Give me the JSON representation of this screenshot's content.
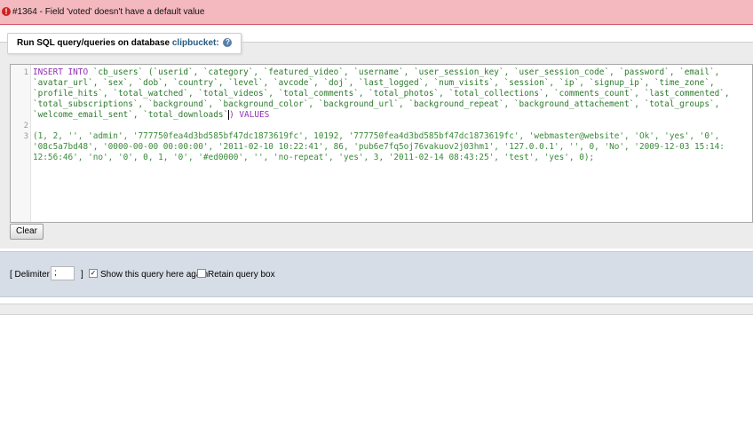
{
  "error": {
    "icon": "error-icon",
    "text": "#1364 - Field 'voted' doesn't have a default value"
  },
  "query_panel": {
    "legend_prefix": "Run SQL query/queries on database",
    "database": "clipbucket:",
    "help_icon": "help-icon"
  },
  "editor": {
    "line_numbers": [
      "1",
      "2",
      "3"
    ],
    "insert_keyword": "INSERT INTO",
    "sql_lines": [
      " `cb_users` (`userid`, `category`, `featured_video`, `username`, `user_session_key`, `user_session_code`, `password`, `email`,",
      "`avatar_url`, `sex`, `dob`, `country`, `level`, `avcode`, `doj`, `last_logged`, `num_visits`, `session`, `ip`, `signup_ip`, `time_zone`,",
      "`profile_hits`, `total_watched`, `total_videos`, `total_comments`, `total_photos`, `total_collections`, `comments_count`, `last_commented`,",
      "`total_subscriptions`, `background`, `background_color`, `background_url`, `background_repeat`, `background_attachement`, `total_groups`,",
      "`welcome_email_sent`, `total_downloads`"
    ],
    "values_keyword": ") VALUES",
    "value_lines": [
      "(1, 2, '', 'admin', '777750fea4d3bd585bf47dc1873619fc', 10192, '777750fea4d3bd585bf47dc1873619fc', 'webmaster@website', 'Ok', 'yes', '0',",
      "'08c5a7bd48', '0000-00-00 00:00:00', '2011-02-10 10:22:41', 86, 'pub6e7fq5oj76vakuov2j03hm1', '127.0.0.1', '', 0, 'No', '2009-12-03 15:14:",
      "12:56:46', 'no', '0', 0, 1, '0', '#ed0000', '', 'no-repeat', 'yes', 3, '2011-02-14 08:43:25', 'test', 'yes', 0);"
    ]
  },
  "buttons": {
    "clear": "Clear"
  },
  "options": {
    "delimiter_label": "[ Delimiter",
    "delimiter_value": ";",
    "delimiter_close": "]",
    "show_again_label": "Show this query here again",
    "show_again_checked": true,
    "retain_label": "Retain query box",
    "retain_checked": false
  },
  "colors": {
    "error_bg": "#f4b8bf",
    "keyword": "#8e2fb5",
    "identifier": "#2d7a2d",
    "db_link": "#235a81"
  }
}
